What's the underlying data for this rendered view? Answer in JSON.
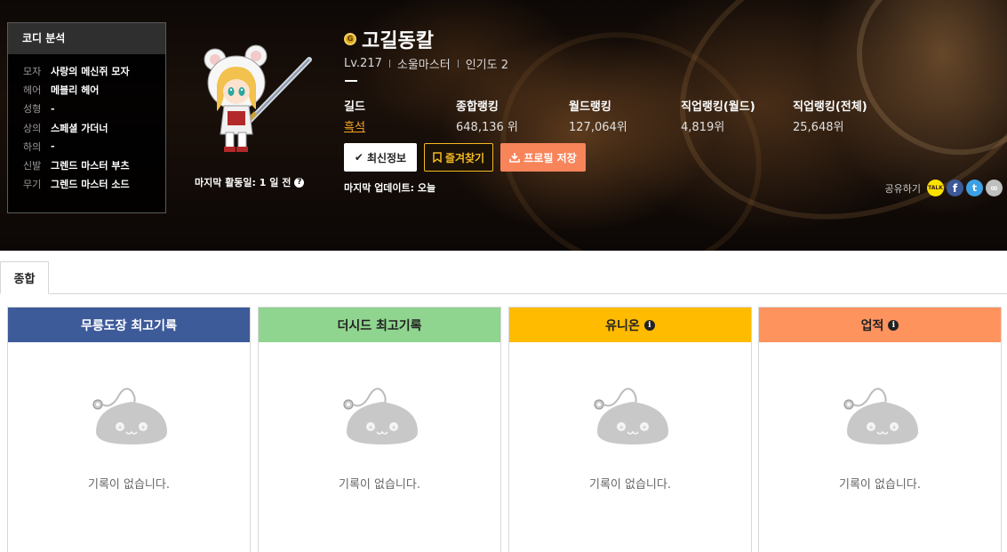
{
  "coordi": {
    "title": "코디 분석",
    "items": [
      {
        "key": "모자",
        "value": "사랑의 메신쥐 모자"
      },
      {
        "key": "헤어",
        "value": "메블리 헤어"
      },
      {
        "key": "성형",
        "value": "-"
      },
      {
        "key": "상의",
        "value": "스페셜 가더너"
      },
      {
        "key": "하의",
        "value": "-"
      },
      {
        "key": "신발",
        "value": "그렌드 마스터 부츠"
      },
      {
        "key": "무기",
        "value": "그렌드 마스터 소드"
      }
    ]
  },
  "character": {
    "name": "고길동칼",
    "level": "Lv.217",
    "job": "소울마스터",
    "popularity": "인기도 2",
    "last_active": "마지막 활동일: 1 일 전",
    "last_update": "마지막 업데이트: 오늘"
  },
  "stats": {
    "guild_label": "길드",
    "guild_value": "흑석",
    "total_rank_label": "종합랭킹",
    "total_rank_value": "648,136 위",
    "world_rank_label": "월드랭킹",
    "world_rank_value": "127,064위",
    "job_world_label": "직업랭킹(월드)",
    "job_world_value": "4,819위",
    "job_all_label": "직업랭킹(전체)",
    "job_all_value": "25,648위"
  },
  "buttons": {
    "latest": "최신정보",
    "favorite": "즐겨찾기",
    "save_profile": "프로필 저장"
  },
  "share": {
    "label": "공유하기",
    "talk": "TALK",
    "icons": [
      "kakaotalk-icon",
      "facebook-icon",
      "twitter-icon",
      "link-icon"
    ]
  },
  "tabs": [
    {
      "label": "종합",
      "active": true
    }
  ],
  "cards": [
    {
      "title": "무릉도장 최고기록",
      "color": "#3d5a99",
      "text_color": "#ffffff",
      "empty": "기록이 없습니다."
    },
    {
      "title": "더시드 최고기록",
      "color": "#8fd48f",
      "text_color": "#222222",
      "empty": "기록이 없습니다."
    },
    {
      "title": "유니온",
      "color": "#ffbb00",
      "text_color": "#222222",
      "empty": "기록이 없습니다."
    },
    {
      "title": "업적",
      "color": "#ff935e",
      "text_color": "#222222",
      "empty": "기록이 없습니다."
    }
  ]
}
